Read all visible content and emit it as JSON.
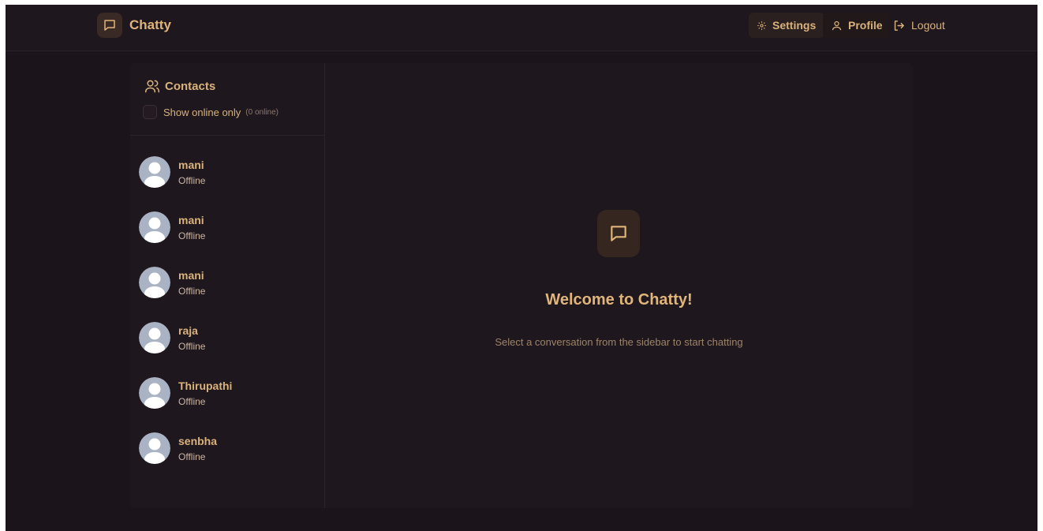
{
  "app": {
    "name": "Chatty"
  },
  "nav": {
    "settings_label": "Settings",
    "profile_label": "Profile",
    "logout_label": "Logout"
  },
  "sidebar": {
    "title": "Contacts",
    "filter_label": "Show online only",
    "online_count": "(0 online)",
    "contacts": [
      {
        "name": "mani",
        "status": "Offline"
      },
      {
        "name": "mani",
        "status": "Offline"
      },
      {
        "name": "mani",
        "status": "Offline"
      },
      {
        "name": "raja",
        "status": "Offline"
      },
      {
        "name": "Thirupathi",
        "status": "Offline"
      },
      {
        "name": "senbha",
        "status": "Offline"
      }
    ]
  },
  "welcome": {
    "title": "Welcome to Chatty!",
    "subtitle": "Select a conversation from the sidebar to start chatting"
  },
  "icons": {
    "brand": "message-square-icon",
    "settings": "gear-icon",
    "profile": "user-icon",
    "logout": "logout-icon",
    "contacts": "users-icon",
    "avatar": "default-avatar-icon"
  },
  "colors": {
    "background": "#1c141b",
    "accent": "#e1b57a",
    "muted": "#9c8468"
  }
}
